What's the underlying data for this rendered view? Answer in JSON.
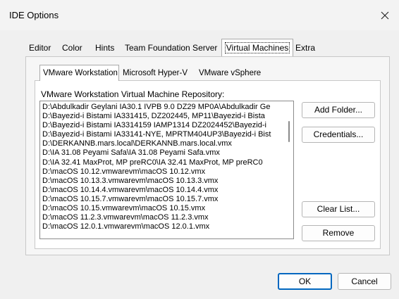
{
  "window": {
    "title": "IDE Options",
    "close_glyph": "✕"
  },
  "outer_tabs": [
    {
      "label": "Editor",
      "active": false
    },
    {
      "label": "Color",
      "active": false
    },
    {
      "label": "Hints",
      "active": false
    },
    {
      "label": "Team Foundation Server",
      "active": false
    },
    {
      "label": "Virtual Machines",
      "active": true
    },
    {
      "label": "Extra",
      "active": false
    }
  ],
  "inner_tabs": [
    {
      "label": "VMware Workstation",
      "active": true
    },
    {
      "label": "Microsoft Hyper-V",
      "active": false
    },
    {
      "label": "VMware vSphere",
      "active": false
    }
  ],
  "repository": {
    "label": "VMware Workstation Virtual Machine Repository:",
    "items": [
      "D:\\Abdulkadir Geylani IA30.1 IVPB 9.0 DZ29 MP0A\\Abdulkadir Ge",
      "D:\\Bayezid-i Bistami IA331415, DZ202445, MP11\\Bayezid-i Bista",
      "D:\\Bayezid-i Bistami IA3314159 IAMP1314 DZ2024452\\Bayezid-i",
      "D:\\Bayezid-i Bistami IA33141-NYE, MPRTM404UP3\\Bayezid-i Bist",
      "D:\\DERKANNB.mars.local\\DERKANNB.mars.local.vmx",
      "D:\\IA 31.08 Peyami Safa\\IA 31.08 Peyami Safa.vmx",
      "D:\\IA 32.41 MaxProt, MP preRC0\\IA 32.41 MaxProt, MP preRC0",
      "D:\\macOS 10.12.vmwarevm\\macOS 10.12.vmx",
      "D:\\macOS 10.13.3.vmwarevm\\macOS 10.13.3.vmx",
      "D:\\macOS 10.14.4.vmwarevm\\macOS 10.14.4.vmx",
      "D:\\macOS 10.15.7.vmwarevm\\macOS 10.15.7.vmx",
      "D:\\macOS 10.15.vmwarevm\\macOS 10.15.vmx",
      "D:\\macOS 11.2.3.vmwarevm\\macOS 11.2.3.vmx",
      "D:\\macOS 12.0.1.vmwarevm\\macOS 12.0.1.vmx"
    ]
  },
  "side_buttons": {
    "add_folder": "Add Folder...",
    "credentials": "Credentials...",
    "clear_list": "Clear List...",
    "remove": "Remove"
  },
  "dialog_buttons": {
    "ok": "OK",
    "cancel": "Cancel"
  },
  "colors": {
    "default_button_border": "#0067c0",
    "window_background": "#f0f0f0"
  }
}
